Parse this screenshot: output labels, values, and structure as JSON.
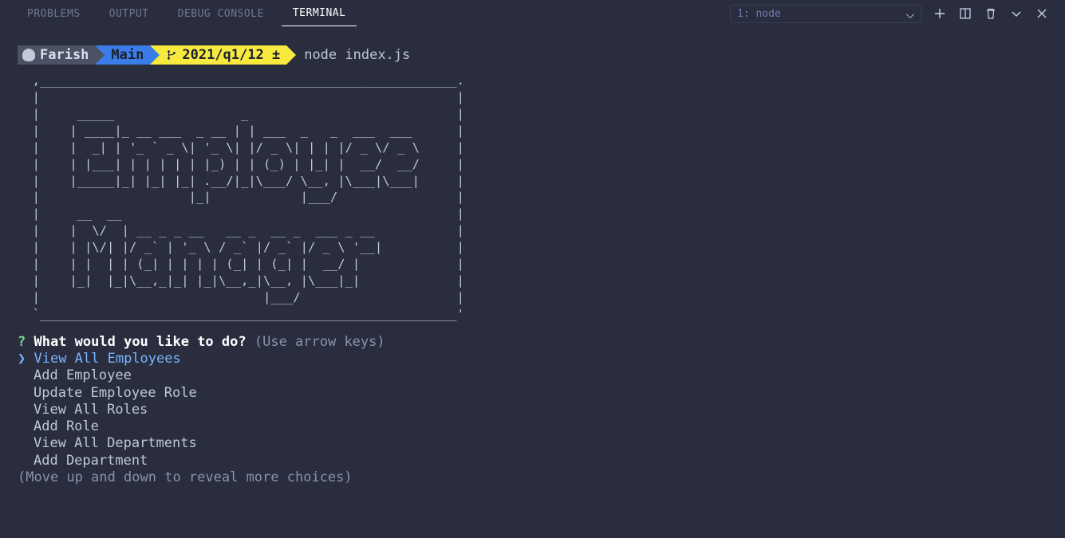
{
  "tabs": {
    "problems": "PROBLEMS",
    "output": "OUTPUT",
    "debug": "DEBUG CONSOLE",
    "terminal": "TERMINAL"
  },
  "terminal_selector": {
    "label": "1: node"
  },
  "prompt": {
    "home": "Farish",
    "branch": "Main",
    "git_path": "2021/q1/12 ±",
    "command": "node index.js"
  },
  "ascii_art": "  ,________________________________________________________.\n  |                                                        |\n  |     _____                 _                            |\n  |    | ____|_ __ ___  _ __ | | ___  _   _  ___  ___      |\n  |    |  _| | '_ ` _ \\| '_ \\| |/ _ \\| | | |/ _ \\/ _ \\     |\n  |    | |___| | | | | | |_) | | (_) | |_| |  __/  __/     |\n  |    |_____|_| |_| |_| .__/|_|\\___/ \\__, |\\___|\\___|     |\n  |                    |_|            |___/                |\n  |     __  __                                             |\n  |    |  \\/  | __ _ _ __   __ _  __ _  ___ _ __           |\n  |    | |\\/| |/ _` | '_ \\ / _` |/ _` |/ _ \\ '__|          |\n  |    | |  | | (_| | | | | (_| | (_| |  __/ |             |\n  |    |_|  |_|\\__,_|_| |_|\\__,_|\\__, |\\___|_|             |\n  |                              |___/                     |\n  `________________________________________________________'",
  "inquirer": {
    "question_mark": "?",
    "question": "What would you like to do?",
    "hint": "(Use arrow keys)",
    "pointer": "❯",
    "options": [
      "View All Employees",
      "Add Employee",
      "Update Employee Role",
      "View All Roles",
      "Add Role",
      "View All Departments",
      "Add Department"
    ],
    "footer_hint": "(Move up and down to reveal more choices)"
  }
}
